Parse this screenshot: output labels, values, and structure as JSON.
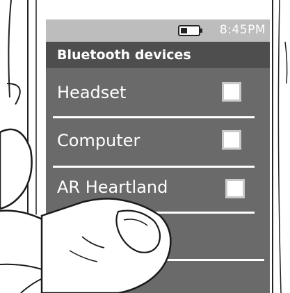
{
  "status_bar": {
    "battery_icon": "battery-icon",
    "time": "8:45PM"
  },
  "header": {
    "title": "Bluetooth devices"
  },
  "devices": [
    {
      "label": "Headset",
      "checked": false
    },
    {
      "label": "Computer",
      "checked": false
    },
    {
      "label": "AR Heartland",
      "checked": false
    }
  ],
  "colors": {
    "screen_bg": "#6a6a6a",
    "status_bar_bg": "#bdbdbd",
    "header_bg": "#4e4e4e",
    "text": "#ffffff"
  }
}
